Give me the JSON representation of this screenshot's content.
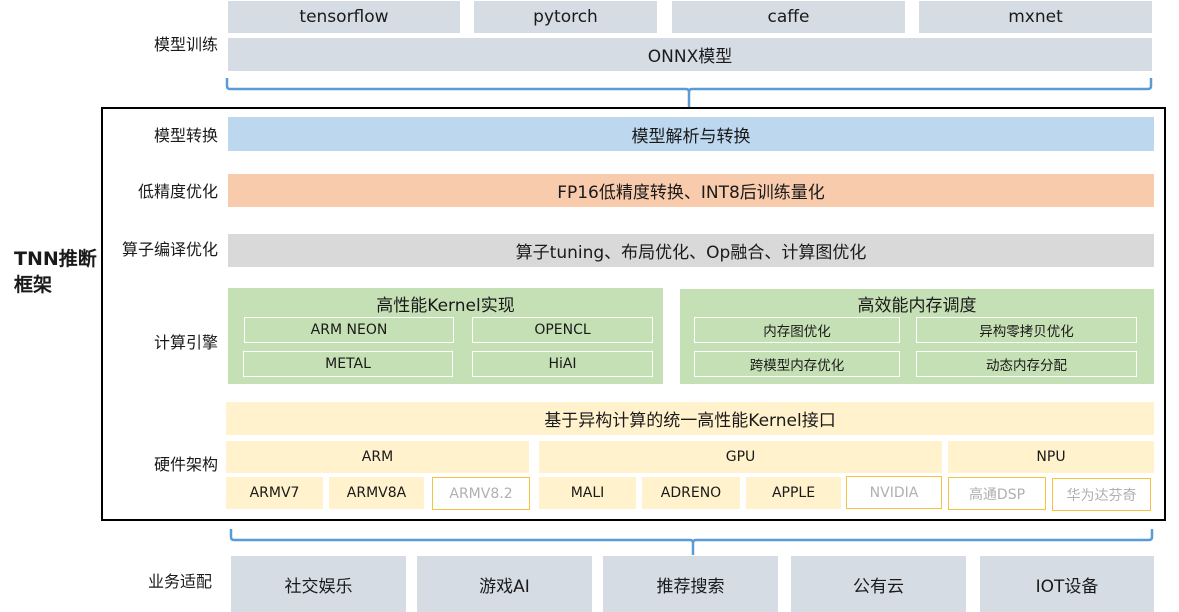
{
  "sections": {
    "training": {
      "label": "模型训练",
      "frameworks": [
        "tensorflow",
        "pytorch",
        "caffe",
        "mxnet"
      ],
      "onnx": "ONNX模型"
    },
    "framework_title": "TNN推断框架",
    "framework_title_lines": [
      "TNN推断",
      "框架"
    ],
    "conversion": {
      "label": "模型转换",
      "content": "模型解析与转换"
    },
    "low_precision": {
      "label": "低精度优化",
      "content": "FP16低精度转换、INT8后训练量化"
    },
    "operator_compile": {
      "label": "算子编译优化",
      "content": "算子tuning、布局优化、Op融合、计算图优化"
    },
    "compute_engine": {
      "label": "计算引擎",
      "kernel": {
        "title": "高性能Kernel实现",
        "items": [
          "ARM NEON",
          "OPENCL",
          "METAL",
          "HiAI"
        ]
      },
      "memory": {
        "title": "高效能内存调度",
        "items": [
          "内存图优化",
          "异构零拷贝优化",
          "跨模型内存优化",
          "动态内存分配"
        ]
      }
    },
    "hardware": {
      "label": "硬件架构",
      "interface": "基于异构计算的统一高性能Kernel接口",
      "groups": [
        {
          "name": "ARM",
          "items": [
            {
              "label": "ARMV7",
              "status": "supported"
            },
            {
              "label": "ARMV8A",
              "status": "supported"
            },
            {
              "label": "ARMV8.2",
              "status": "planned"
            }
          ]
        },
        {
          "name": "GPU",
          "items": [
            {
              "label": "MALI",
              "status": "supported"
            },
            {
              "label": "ADRENO",
              "status": "supported"
            },
            {
              "label": "APPLE",
              "status": "supported"
            },
            {
              "label": "NVIDIA",
              "status": "planned"
            }
          ]
        },
        {
          "name": "NPU",
          "items": [
            {
              "label": "高通DSP",
              "status": "planned"
            },
            {
              "label": "华为达芬奇",
              "status": "planned"
            }
          ]
        }
      ]
    },
    "business": {
      "label": "业务适配",
      "items": [
        "社交娱乐",
        "游戏AI",
        "推荐搜索",
        "公有云",
        "IOT设备"
      ]
    }
  },
  "colors": {
    "training": "#d6dce4",
    "conversion": "#bdd7ee",
    "low_precision": "#f8cbad",
    "operator_compile": "#d9d9d9",
    "compute_engine": "#c5e0b4",
    "hardware": "#fff2cc",
    "planned_border": "#f5c342",
    "brace": "#5b9bd5"
  }
}
